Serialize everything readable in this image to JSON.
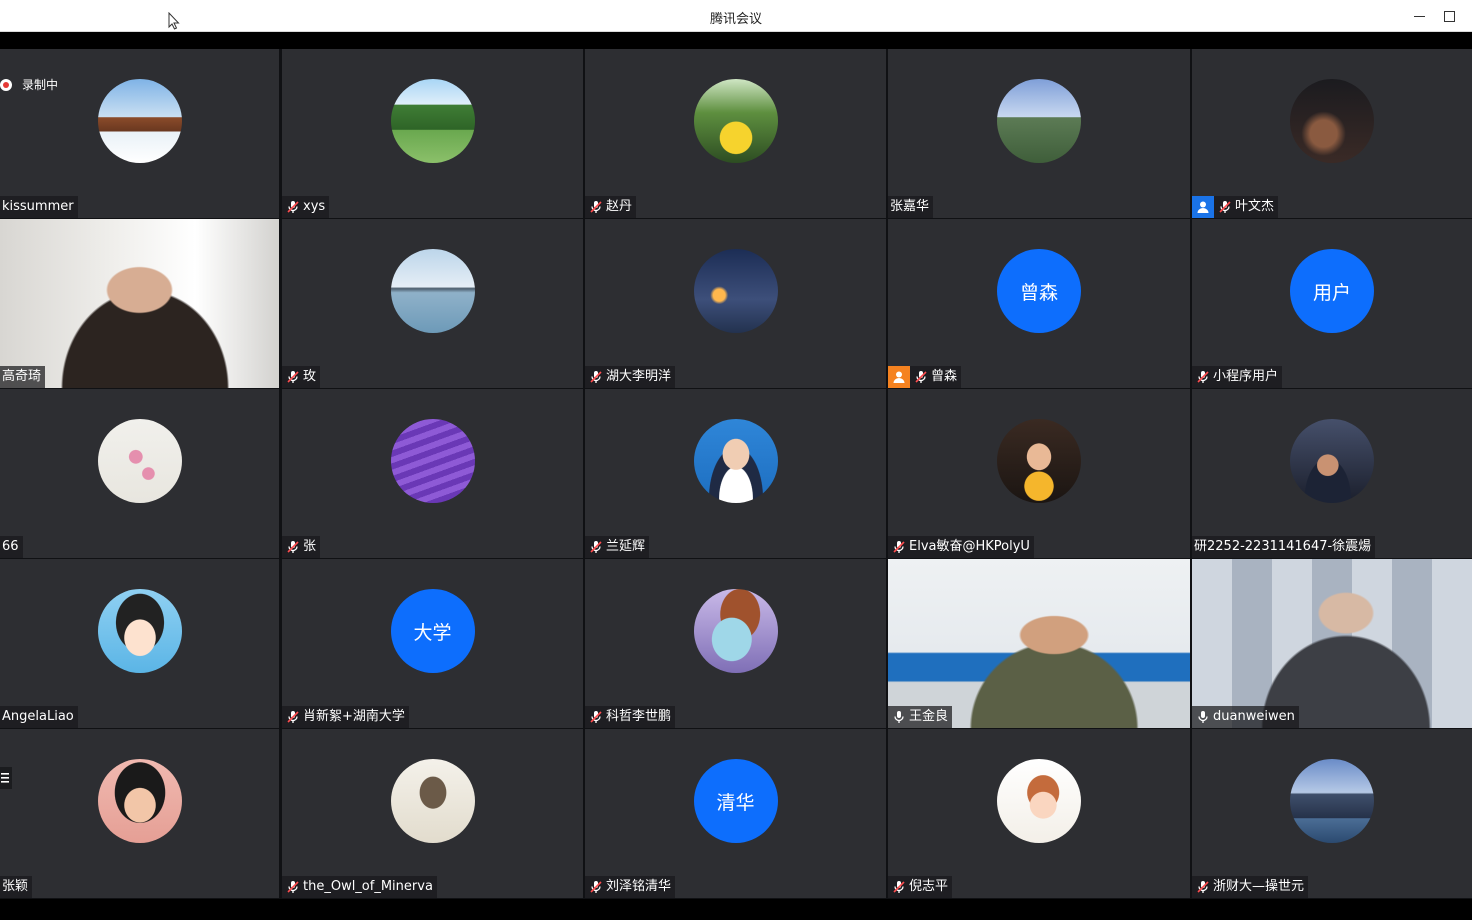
{
  "window": {
    "title": "腾讯会议"
  },
  "recording": {
    "label": "录制中"
  },
  "colors": {
    "tile_bg": "#2d2e32",
    "grid_bg": "#101114",
    "avatar_blue": "#0d6efd",
    "host_orange": "#f58220",
    "cohost_blue": "#1a73e8",
    "speaking_green": "#35c76b"
  },
  "participants": [
    {
      "name": "kissummer",
      "avatar": "photo-snow-cabin",
      "mic": "none",
      "badge": ""
    },
    {
      "name": "xys",
      "avatar": "photo-park-trees",
      "mic": "muted",
      "badge": ""
    },
    {
      "name": "赵丹",
      "avatar": "photo-yellow-flowers",
      "mic": "muted",
      "badge": ""
    },
    {
      "name": "张嘉华",
      "avatar": "photo-mountain-calligraphy",
      "mic": "none",
      "badge": ""
    },
    {
      "name": "叶文杰",
      "avatar": "photo-dark-tiga",
      "mic": "muted",
      "badge": "cohost"
    },
    {
      "name": "高奇琦",
      "avatar": "video-man-glasses",
      "mic": "none",
      "badge": ""
    },
    {
      "name": "玫",
      "avatar": "photo-lake-pagoda",
      "mic": "muted",
      "badge": ""
    },
    {
      "name": "湖大李明洋",
      "avatar": "photo-anime-night",
      "mic": "muted",
      "badge": ""
    },
    {
      "name": "曾森",
      "avatar_text": "曾森",
      "mic": "muted",
      "badge": "host"
    },
    {
      "name": "小程序用户",
      "avatar_text": "用户",
      "mic": "muted",
      "badge": ""
    },
    {
      "name": "66",
      "avatar": "photo-plum-blossom",
      "mic": "none",
      "badge": ""
    },
    {
      "name": "张",
      "avatar": "photo-lavender",
      "mic": "muted",
      "badge": ""
    },
    {
      "name": "兰延辉",
      "avatar": "photo-portrait-blue",
      "mic": "muted",
      "badge": ""
    },
    {
      "name": "Elva敏奋@HKPolyU",
      "avatar": "photo-child-lights",
      "mic": "muted",
      "badge": ""
    },
    {
      "name": "研2252-2231141647-徐震煬",
      "avatar": "photo-man-night-street",
      "mic": "none",
      "badge": ""
    },
    {
      "name": "AngelaLiao",
      "avatar": "cartoon-girl",
      "mic": "none",
      "badge": ""
    },
    {
      "name": "肖新絮+湖南大学",
      "avatar_text": "大学",
      "mic": "muted",
      "badge": ""
    },
    {
      "name": "科哲李世鹏",
      "avatar": "anime-witch",
      "mic": "muted",
      "badge": ""
    },
    {
      "name": "王金良",
      "avatar": "video-man-office",
      "mic": "on",
      "badge": ""
    },
    {
      "name": "duanweiwen",
      "avatar": "video-man-robots",
      "mic": "on",
      "badge": ""
    },
    {
      "name": "张颖",
      "avatar": "anime-girl-green",
      "mic": "none",
      "badge": ""
    },
    {
      "name": "the_Owl_of_Minerva",
      "avatar": "drawing-owl",
      "mic": "muted",
      "badge": ""
    },
    {
      "name": "刘泽铭清华",
      "avatar_text": "清华",
      "mic": "muted",
      "badge": ""
    },
    {
      "name": "倪志平",
      "avatar": "cartoon-study",
      "mic": "muted",
      "badge": ""
    },
    {
      "name": "浙财大—操世元",
      "avatar": "photo-city-skyline",
      "mic": "muted",
      "badge": ""
    }
  ]
}
